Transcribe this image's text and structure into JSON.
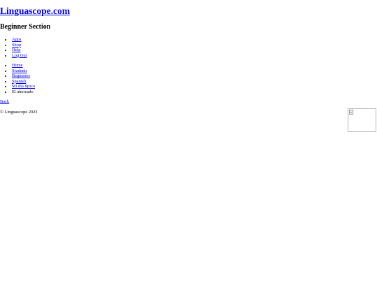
{
  "site": {
    "title": "Linguascope.com",
    "top_right_text": "· · ·"
  },
  "section": {
    "title": "Beginner Section"
  },
  "user_menu": {
    "items": [
      {
        "label": "Apps"
      },
      {
        "label": "Shop"
      },
      {
        "label": "Help"
      },
      {
        "label": "Log Out"
      }
    ]
  },
  "breadcrumb": {
    "items": [
      {
        "label": "Home"
      },
      {
        "label": "Students"
      },
      {
        "label": "Beginners"
      },
      {
        "label": "Spanish"
      },
      {
        "label": "Mi día típico"
      }
    ],
    "current": "El ahorcado"
  },
  "back": {
    "label": "Back"
  },
  "footer": {
    "copyright": "© Linguascope 2023"
  }
}
